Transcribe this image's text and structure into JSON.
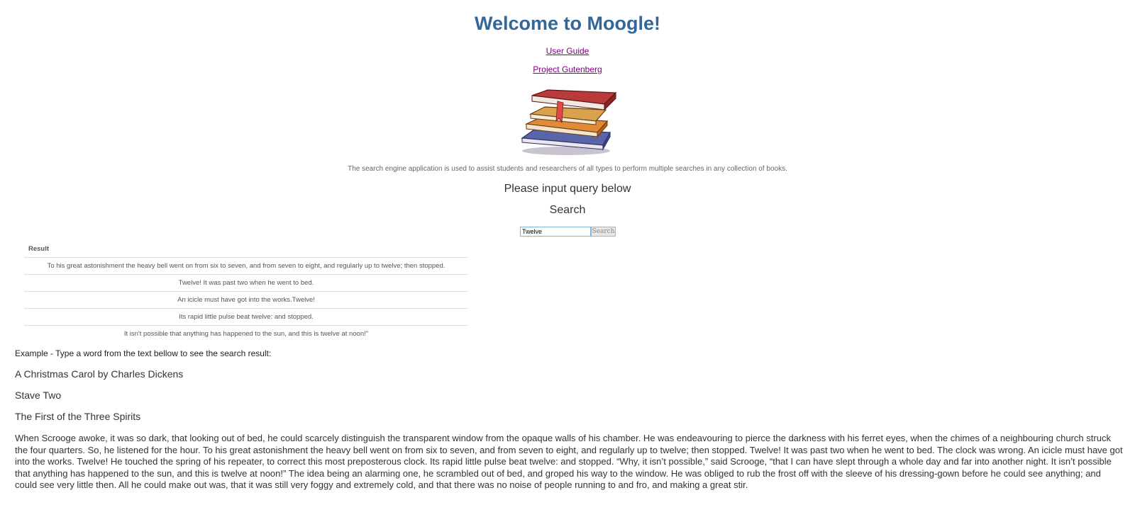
{
  "header": {
    "title": "Welcome to Moogle!",
    "links": [
      {
        "label": "User Guide"
      },
      {
        "label": "Project Gutenberg"
      }
    ]
  },
  "logo": {
    "icon": "stack-of-books-icon"
  },
  "description": "The search engine application is used to assist students and researchers of all types to perform multiple searches in any collection of books.",
  "prompt": "Please input query below",
  "search_heading": "Search",
  "search": {
    "value": "Twelve",
    "button_label": "Search"
  },
  "results": {
    "header": "Result",
    "rows": [
      "To his great astonishment the heavy bell went on from six to seven, and from seven to eight, and regularly up to twelve; then stopped.",
      "Twelve! It was past two when he went to bed.",
      "An icicle must have got into the works.Twelve!",
      "Its rapid little pulse beat twelve: and stopped.",
      "It isn't possible that anything has happened to the sun, and this is twelve at noon!\""
    ]
  },
  "example": {
    "instruction": "Example - Type a word from the text bellow to see the search result:",
    "book_title": "A Christmas Carol by Charles Dickens",
    "stave": "Stave Two",
    "chapter": "The First of the Three Spirits",
    "text": "When Scrooge awoke, it was so dark, that looking out of bed, he could scarcely distinguish the transparent window from the opaque walls of his chamber. He was endeavouring to pierce the darkness with his ferret eyes, when the chimes of a neighbouring church struck the four quarters. So, he listened for the hour. To his great astonishment the heavy bell went on from six to seven, and from seven to eight, and regularly up to twelve; then stopped. Twelve! It was past two when he went to bed. The clock was wrong. An icicle must have got into the works. Twelve! He touched the spring of his repeater, to correct this most preposterous clock. Its rapid little pulse beat twelve: and stopped. “Why, it isn’t possible,” said Scrooge, “that I can have slept through a whole day and far into another night. It isn’t possible that anything has happened to the sun, and this is twelve at noon!” The idea being an alarming one, he scrambled out of bed, and groped his way to the window. He was obliged to rub the frost off with the sleeve of his dressing-gown before he could see anything; and could see very little then. All he could make out was, that it was still very foggy and extremely cold, and that there was no noise of people running to and fro, and making a great stir."
  },
  "colors": {
    "title": "#336699",
    "link": "#800080",
    "text": "#333333"
  }
}
